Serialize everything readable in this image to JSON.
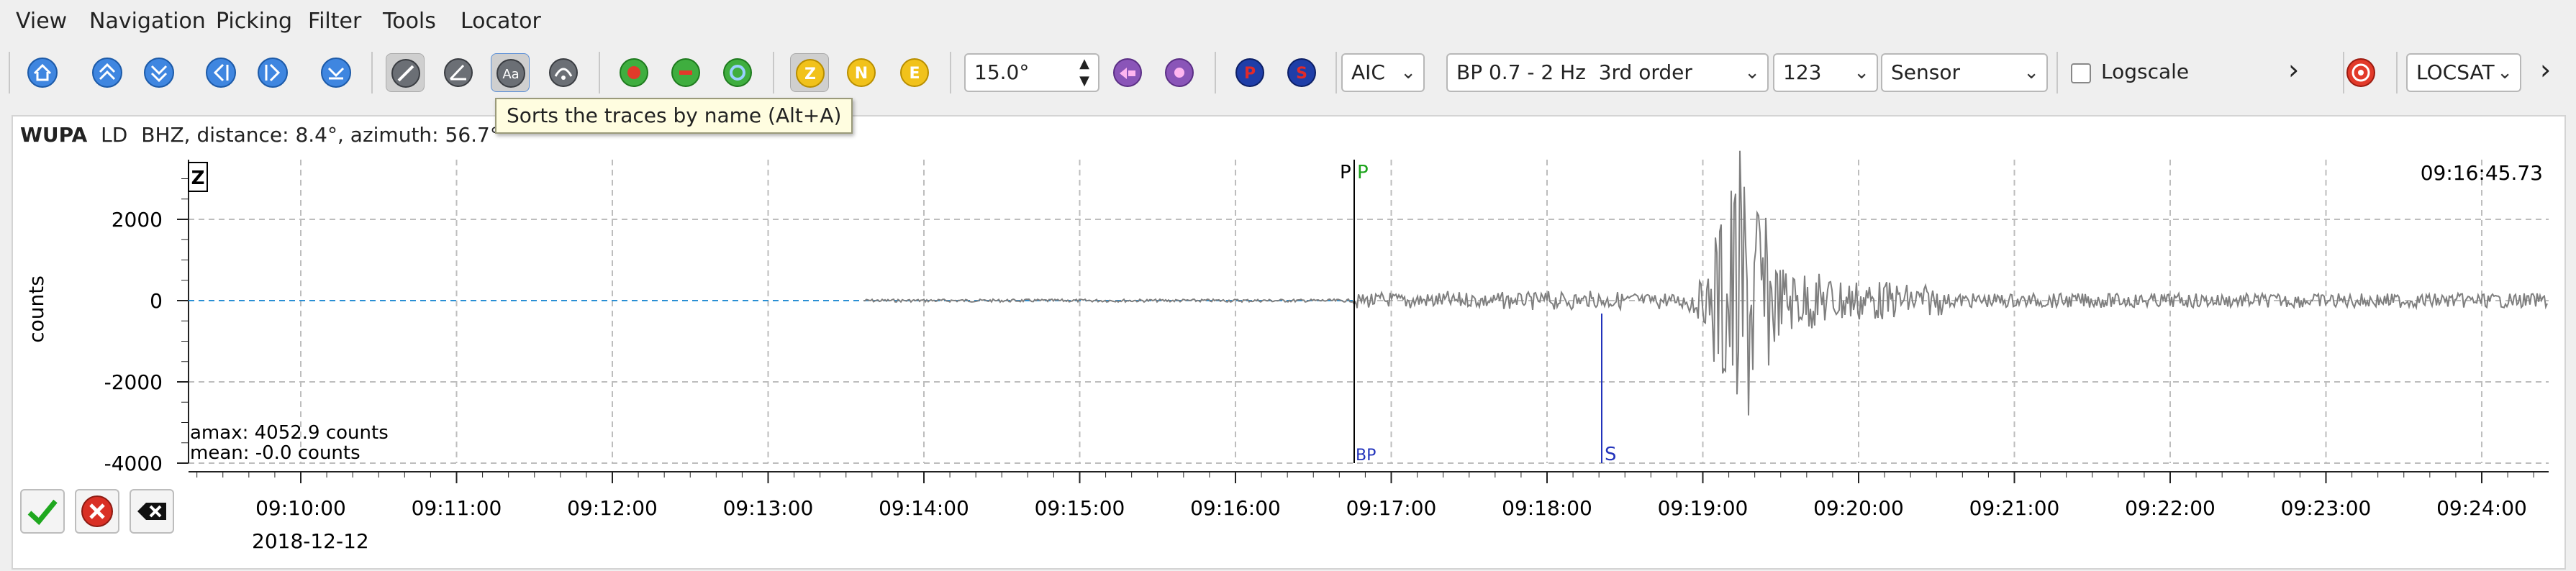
{
  "menu": [
    "View",
    "Navigation",
    "Picking",
    "Filter",
    "Tools",
    "Locator"
  ],
  "toolbar": {
    "component_buttons": [
      "Z",
      "N",
      "E"
    ],
    "rotation_value": "15.0°",
    "picker_buttons": [
      "P",
      "S"
    ],
    "method_select": "AIC",
    "filter_select": "BP 0.7 - 2 Hz  3rd order",
    "channel_select": "123",
    "unit_select": "Sensor",
    "logscale_label": "Logscale",
    "more_glyph": "›",
    "locator_select": "LOCSAT",
    "overflow_glyph": "›"
  },
  "tooltip": "Sorts the traces by name (Alt+A)",
  "trace_header": {
    "station": "WUPA",
    "network": "LD",
    "info": "BHZ, distance: 8.4°, azimuth: 56.7°"
  },
  "trace": {
    "component_label": "Z",
    "time_label": "09:16:45.73",
    "ylabel": "counts",
    "yticks": [
      "2000",
      "0",
      "-2000",
      "-4000"
    ],
    "xticks": [
      "09:10:00",
      "09:11:00",
      "09:12:00",
      "09:13:00",
      "09:14:00",
      "09:15:00",
      "09:16:00",
      "09:17:00",
      "09:18:00",
      "09:19:00",
      "09:20:00",
      "09:21:00",
      "09:22:00",
      "09:23:00",
      "09:24:00"
    ],
    "date": "2018-12-12",
    "amax": "amax: 4052.9 counts",
    "mean": "mean: -0.0 counts",
    "pick_labels": {
      "p_black": "P",
      "p_green": "P",
      "s_blue": "S",
      "bottom": "BP"
    }
  },
  "colors": {
    "p_pick_black": "#000000",
    "p_pick_green": "#1ba31b",
    "s_pick_blue": "#2233bb",
    "trace": "#7f7f7f",
    "grid": "#bdbdbd",
    "baseline": "#2a8fd4",
    "tooltip_bg": "#fffde0"
  },
  "icons": [
    "home-icon",
    "scroll-up-icon",
    "scroll-down-icon",
    "back-icon",
    "forward-icon",
    "down-icon",
    "sort-distance-icon",
    "sort-azimuth-icon",
    "sort-name-icon",
    "sort-residual-icon",
    "pick-icon",
    "delete-pick-icon",
    "relocate-icon",
    "rotate-ccw-icon",
    "rotate-cw-icon",
    "target-icon",
    "accept-icon",
    "reject-icon",
    "clear-icon"
  ]
}
